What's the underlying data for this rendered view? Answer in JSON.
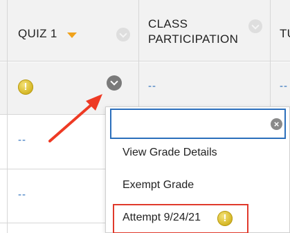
{
  "columns": {
    "quiz": "QUIZ 1",
    "class_participation": "CLASS PARTICIPATION",
    "next_partial": "TU"
  },
  "cells": {
    "empty_value": "--",
    "needs_grading_icon": "exclamation-icon"
  },
  "menu": {
    "search_value": "",
    "search_placeholder": "",
    "items": {
      "view_grade_details": "View Grade Details",
      "exempt_grade": "Exempt Grade",
      "attempt": "Attempt 9/24/21"
    }
  },
  "colors": {
    "link_blue": "#2a6ebb",
    "highlight_red": "#e0392b",
    "sort_caret": "#f0a21b",
    "header_bg": "#f2f2f2"
  }
}
